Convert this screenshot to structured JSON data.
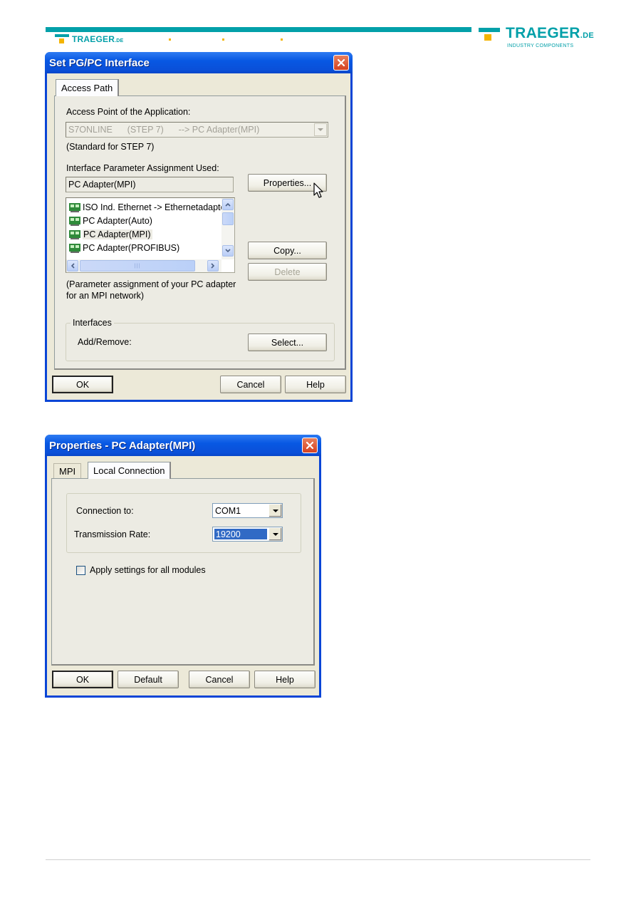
{
  "header": {
    "brand_small": "TRAEGER",
    "brand_small_suffix": ".DE",
    "brand_big": "TRAEGER",
    "brand_big_suffix": ".DE",
    "brand_tagline": "INDUSTRY COMPONENTS",
    "accent_color": "#03a0a9",
    "dot_color": "#f4b400"
  },
  "dialog1": {
    "title": "Set PG/PC Interface",
    "tabs": [
      {
        "label": "Access Path",
        "active": true
      }
    ],
    "access_point_label": "Access Point of the Application:",
    "access_point_value": "S7ONLINE      (STEP 7)      --> PC Adapter(MPI)",
    "access_point_note": "(Standard for STEP 7)",
    "param_label": "Interface Parameter Assignment Used:",
    "param_value": "PC Adapter(MPI)",
    "list_items": [
      {
        "label": "ISO Ind. Ethernet -> Ethernetadapte",
        "icon": "adapter-icon"
      },
      {
        "label": "PC Adapter(Auto)",
        "icon": "adapter-icon"
      },
      {
        "label": "PC Adapter(MPI)",
        "icon": "adapter-icon",
        "selected": true
      },
      {
        "label": "PC Adapter(PROFIBUS)",
        "icon": "adapter-icon"
      }
    ],
    "description": "(Parameter assignment of your PC adapter",
    "description2": "for an MPI network)",
    "buttons": {
      "properties": "Properties...",
      "copy": "Copy...",
      "delete": "Delete",
      "ok": "OK",
      "cancel": "Cancel",
      "help": "Help"
    },
    "interfaces_group": {
      "title": "Interfaces",
      "label": "Add/Remove:",
      "select_button": "Select..."
    }
  },
  "dialog2": {
    "title": "Properties - PC Adapter(MPI)",
    "tabs": [
      {
        "label": "MPI",
        "active": false
      },
      {
        "label": "Local Connection",
        "active": true
      }
    ],
    "connection_label": "Connection to:",
    "connection_value": "COM1",
    "rate_label": "Transmission Rate:",
    "rate_value": "19200",
    "apply_all_label": "Apply settings for all modules",
    "apply_all_checked": false,
    "buttons": {
      "ok": "OK",
      "default": "Default",
      "cancel": "Cancel",
      "help": "Help"
    }
  }
}
